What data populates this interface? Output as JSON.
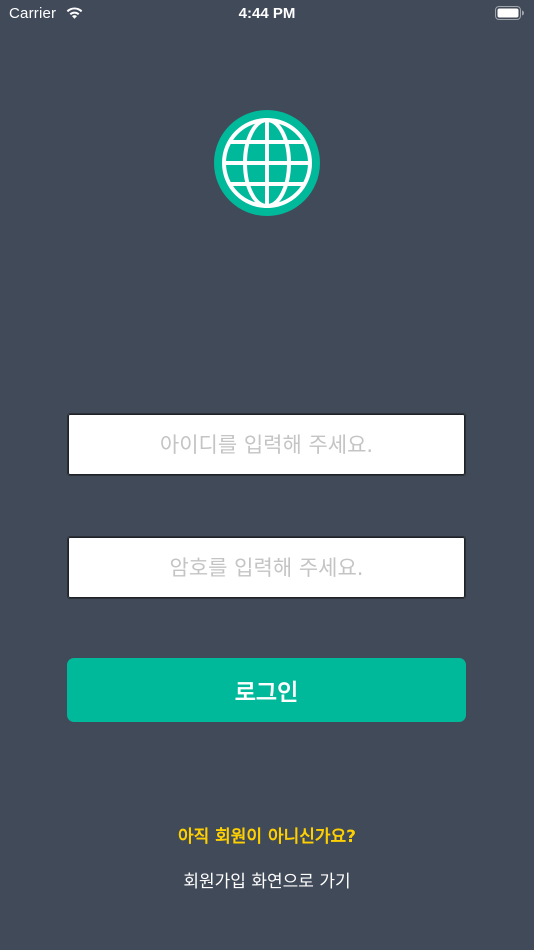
{
  "status_bar": {
    "carrier": "Carrier",
    "time": "4:44 PM"
  },
  "logo": {
    "icon": "globe-icon",
    "color": "#00b89a"
  },
  "form": {
    "id_placeholder": "아이디를 입력해 주세요.",
    "password_placeholder": "암호를 입력해 주세요.",
    "login_label": "로그인"
  },
  "signup": {
    "question": "아직 회원이 아니신가요?",
    "link_label": "회원가입 화연으로 가기"
  },
  "colors": {
    "background": "#414a59",
    "accent": "#00b89a",
    "highlight": "#ffd000"
  }
}
